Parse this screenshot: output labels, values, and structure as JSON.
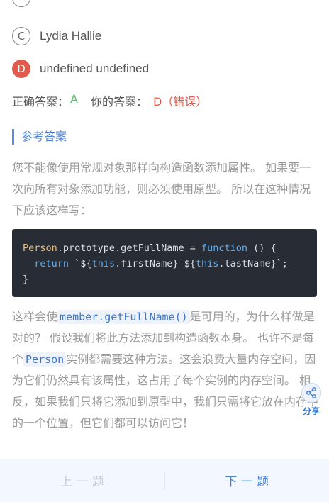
{
  "options": [
    {
      "letter": "C",
      "text": "Lydia Hallie"
    },
    {
      "letter": "D",
      "text": "undefined undefined"
    }
  ],
  "answer": {
    "correct_label": "正确答案：",
    "correct_value": "A",
    "yours_label": "你的答案：",
    "yours_value": "D（错误）"
  },
  "reference_title": "参考答案",
  "paragraph1": "您不能像使用常规对象那样向构造函数添加属性。 如果要一次向所有对象添加功能，则必须使用原型。 所以在这种情况下应该这样写：",
  "code": {
    "line1_class": "Person",
    "line1_rest": ".prototype.getFullName = ",
    "line1_kw": "function",
    "line1_end": " () {",
    "line2_kw": "return",
    "line2_a": " `${",
    "line2_this1": "this",
    "line2_b": ".firstName} ${",
    "line2_this2": "this",
    "line2_c": ".lastName}`;",
    "line3": "}"
  },
  "paragraph2": {
    "p1": "这样会使",
    "code1": "member.getFullName()",
    "p2": "是可用的，为什么样做是对的？ 假设我们将此方法添加到构造函数本身。 也许不是每个",
    "code2": "Person",
    "p3": "实例都需要这种方法。这会浪费大量内存空间，因为它们仍然具有该属性，这占用了每个实例的内存空间。 相反，如果我们只将它添加到原型中，我们只需将它放在内存中的一个位置，但它们都可以访问它！"
  },
  "share_label": "分享",
  "nav": {
    "prev": "上 一 题",
    "next": "下 一 题"
  },
  "colors": {
    "accent": "#4a7fd8",
    "correct": "#56c26a",
    "wrong": "#e05b4b",
    "code_bg": "#282c34"
  }
}
